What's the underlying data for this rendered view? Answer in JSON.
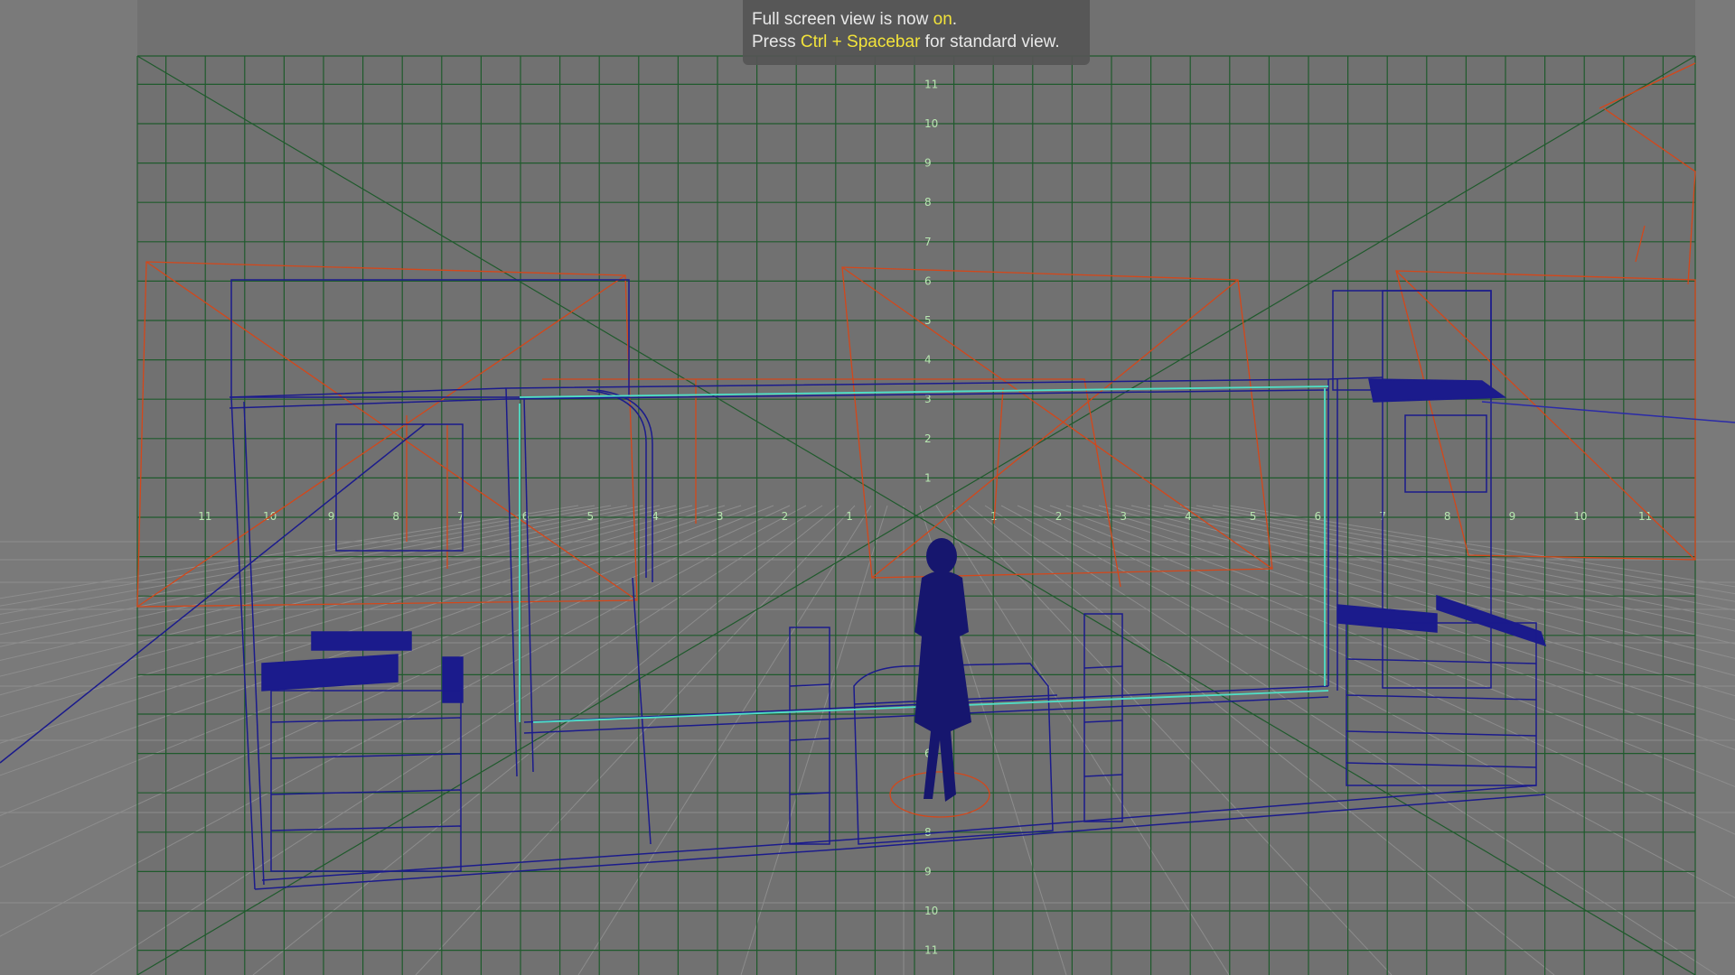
{
  "banner": {
    "line1_prefix": "Full screen view is now ",
    "line1_state": "on",
    "line1_suffix": ".",
    "line2_prefix": "Press ",
    "line2_shortcut": "Ctrl + Spacebar",
    "line2_suffix": " for standard view."
  },
  "grid_ticks": {
    "horizontal": [
      "11",
      "10",
      "9",
      "8",
      "7",
      "6",
      "5",
      "4",
      "3",
      "2",
      "1",
      "1",
      "2",
      "3",
      "4",
      "5",
      "6",
      "7",
      "8",
      "9",
      "10",
      "11"
    ],
    "vertical": [
      "11",
      "10",
      "9",
      "8",
      "7",
      "6",
      "5",
      "4",
      "3",
      "2",
      "1",
      "2",
      "3",
      "4",
      "5",
      "6",
      "7",
      "8",
      "9",
      "10",
      "11"
    ]
  },
  "colors": {
    "viewport_bg": "#717171",
    "grid": "#1f5a2c",
    "wireframe": "#1b1b8c",
    "lights": "#d4471a",
    "highlight": "#f2e33a"
  }
}
